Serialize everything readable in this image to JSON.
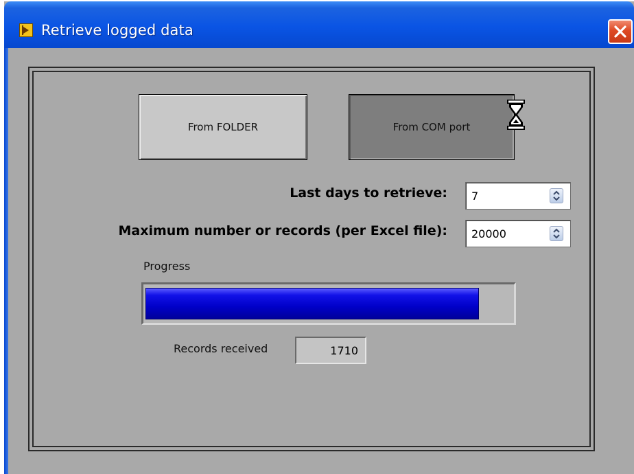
{
  "window": {
    "title": "Retrieve logged data",
    "app_icon": "labview-vi-icon",
    "close_icon": "close-x-icon",
    "title_bar_color": "#0a54e4",
    "close_button_color": "#de4a24"
  },
  "buttons": {
    "from_folder_label": "From FOLDER",
    "from_com_label": "From COM port",
    "busy_cursor_icon": "hourglass-icon"
  },
  "fields": {
    "last_days": {
      "label": "Last days to retrieve:",
      "value": "7",
      "spinner_icon": "spinner-updown-icon"
    },
    "max_records": {
      "label": "Maximum number or records (per Excel file):",
      "value": "20000",
      "spinner_icon": "spinner-updown-icon"
    }
  },
  "progress": {
    "label": "Progress",
    "percent": 91,
    "fill_color": "#0000c8"
  },
  "records": {
    "label": "Records received",
    "value": "1710"
  }
}
